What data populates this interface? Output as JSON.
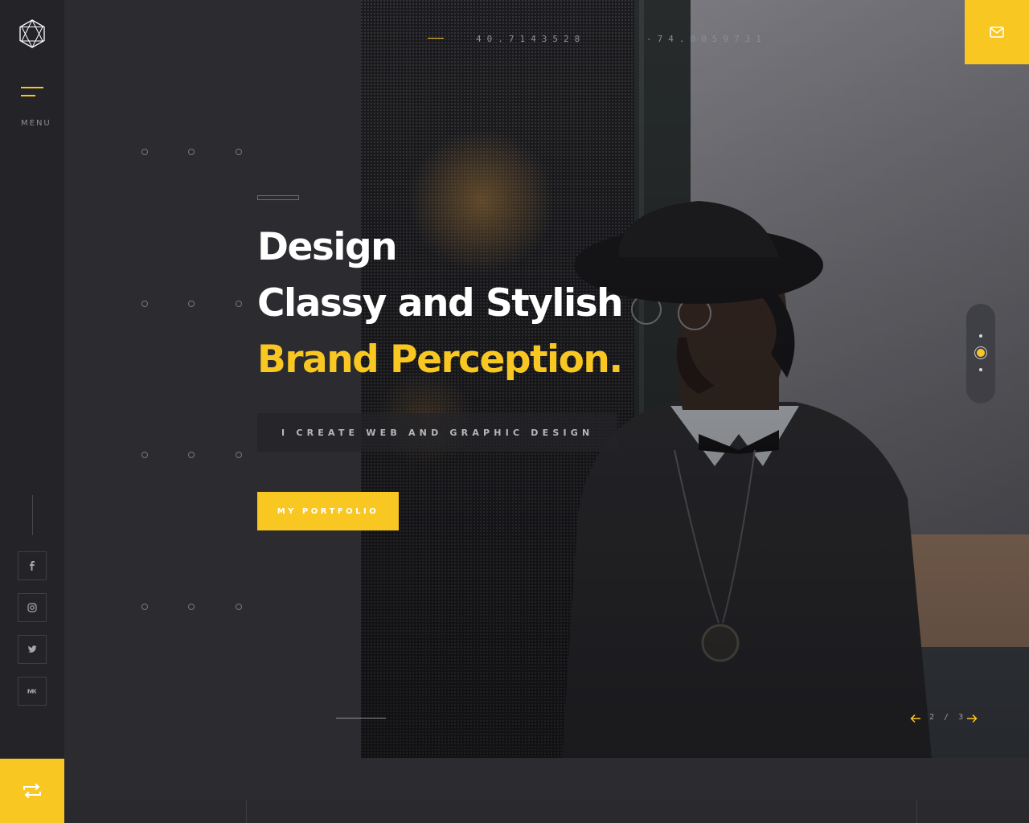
{
  "sidebar": {
    "menu_label": "MENU",
    "social": [
      {
        "name": "facebook",
        "icon": "facebook-icon"
      },
      {
        "name": "instagram",
        "icon": "instagram-icon"
      },
      {
        "name": "twitter",
        "icon": "twitter-icon"
      },
      {
        "name": "vk",
        "icon": "vk-icon"
      }
    ],
    "reload_icon": "repeat-icon"
  },
  "coords": {
    "lat": "40.7143528",
    "lng": "-74.0059731"
  },
  "header": {
    "mail_icon": "envelope-icon"
  },
  "hero": {
    "line1": "Design",
    "line2": "Classy and Stylish",
    "line3": "Brand Perception.",
    "tagline": "I CREATE WEB AND GRAPHIC DESIGN",
    "button_label": "MY PORTFOLIO"
  },
  "slider": {
    "current": 2,
    "total": 3,
    "counter": "2 / 3"
  },
  "colors": {
    "accent": "#f9c722",
    "background": "#2b2b30",
    "sidebar": "#242428"
  }
}
